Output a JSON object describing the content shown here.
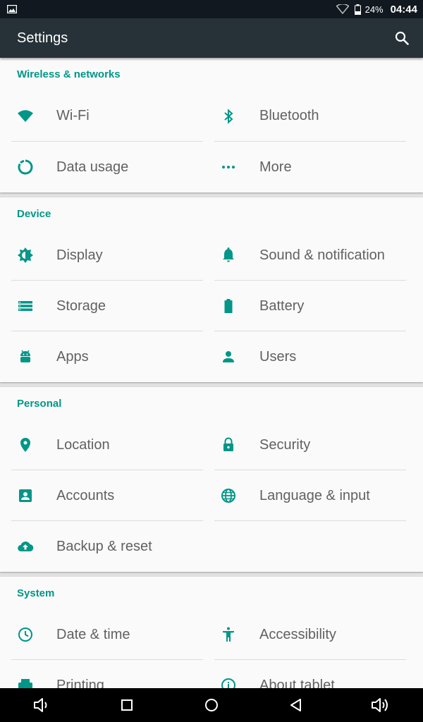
{
  "status_bar": {
    "battery_percent": "24%",
    "time": "04:44"
  },
  "action_bar": {
    "title": "Settings"
  },
  "accent_color": "#009688",
  "sections": [
    {
      "header": "Wireless & networks",
      "items": [
        {
          "label": "Wi-Fi",
          "icon": "wifi-icon"
        },
        {
          "label": "Bluetooth",
          "icon": "bluetooth-icon"
        },
        {
          "label": "Data usage",
          "icon": "data-usage-icon"
        },
        {
          "label": "More",
          "icon": "more-icon"
        }
      ]
    },
    {
      "header": "Device",
      "items": [
        {
          "label": "Display",
          "icon": "brightness-icon"
        },
        {
          "label": "Sound & notification",
          "icon": "bell-icon"
        },
        {
          "label": "Storage",
          "icon": "storage-icon"
        },
        {
          "label": "Battery",
          "icon": "battery-icon"
        },
        {
          "label": "Apps",
          "icon": "android-icon"
        },
        {
          "label": "Users",
          "icon": "person-icon"
        }
      ]
    },
    {
      "header": "Personal",
      "items": [
        {
          "label": "Location",
          "icon": "location-pin-icon"
        },
        {
          "label": "Security",
          "icon": "lock-icon"
        },
        {
          "label": "Accounts",
          "icon": "account-box-icon"
        },
        {
          "label": "Language & input",
          "icon": "globe-icon"
        },
        {
          "label": "Backup & reset",
          "icon": "cloud-upload-icon"
        }
      ]
    },
    {
      "header": "System",
      "items": [
        {
          "label": "Date & time",
          "icon": "clock-icon"
        },
        {
          "label": "Accessibility",
          "icon": "accessibility-icon"
        },
        {
          "label": "Printing",
          "icon": "print-icon"
        },
        {
          "label": "About tablet",
          "icon": "info-icon"
        }
      ]
    }
  ],
  "nav_bar": [
    "volume-down-icon",
    "recents-icon",
    "home-icon",
    "back-icon",
    "volume-up-icon"
  ]
}
